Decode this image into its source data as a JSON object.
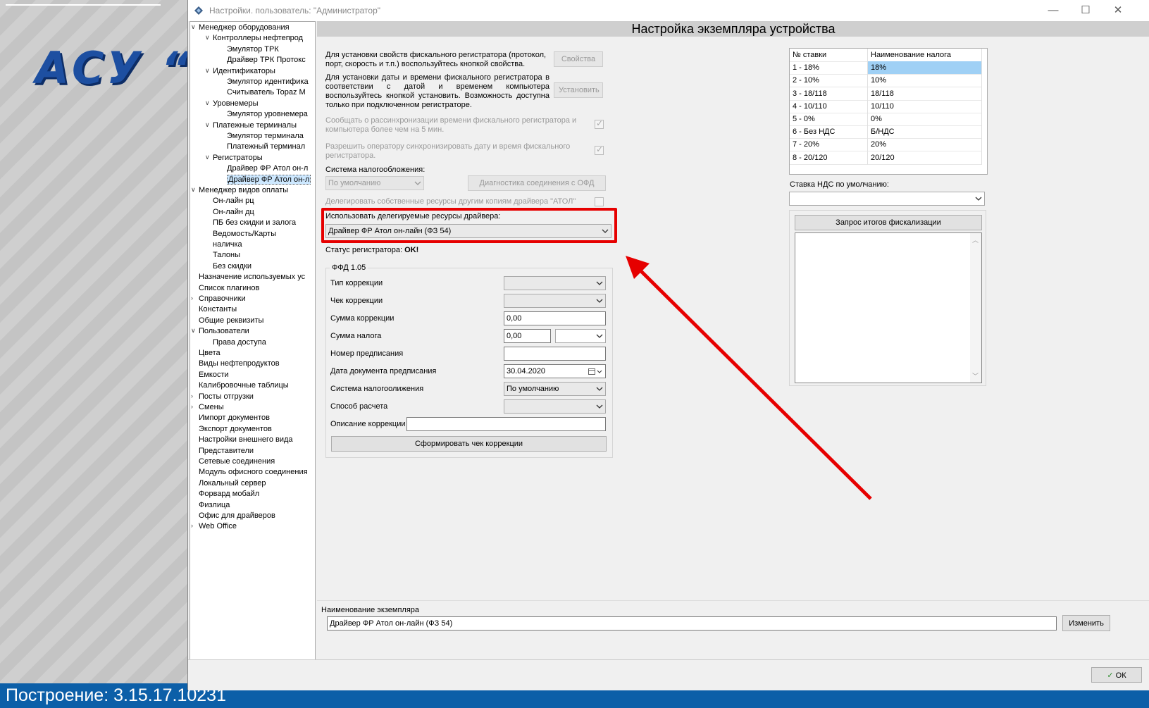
{
  "window": {
    "title": "Настройки. пользователь: \"Администратор\"",
    "minimize": "—",
    "maximize": "☐",
    "close": "✕"
  },
  "background": {
    "logo_text": "АСУ “",
    "build": "Построение: 3.15.17.10231"
  },
  "tree": {
    "items": [
      {
        "label": "Менеджер оборудования",
        "level": 0,
        "toggle": "expanded"
      },
      {
        "label": "Контроллеры нефтепрод",
        "level": 1,
        "toggle": "expanded"
      },
      {
        "label": "Эмулятор ТРК",
        "level": 2
      },
      {
        "label": "Драйвер ТРК Протокс",
        "level": 2
      },
      {
        "label": "Идентификаторы",
        "level": 1,
        "toggle": "expanded"
      },
      {
        "label": "Эмулятор идентифика",
        "level": 2
      },
      {
        "label": "Считыватель Topaz M",
        "level": 2
      },
      {
        "label": "Уровнемеры",
        "level": 1,
        "toggle": "expanded"
      },
      {
        "label": "Эмулятор уровнемера",
        "level": 2
      },
      {
        "label": "Платежные терминалы",
        "level": 1,
        "toggle": "expanded"
      },
      {
        "label": "Эмулятор терминала",
        "level": 2
      },
      {
        "label": "Платежный терминал",
        "level": 2
      },
      {
        "label": "Регистраторы",
        "level": 1,
        "toggle": "expanded"
      },
      {
        "label": "Драйвер ФР Атол он-л",
        "level": 2
      },
      {
        "label": "Драйвер ФР Атол он-л",
        "level": 2,
        "selected": true
      },
      {
        "label": "Менеджер видов оплаты",
        "level": 0,
        "toggle": "expanded"
      },
      {
        "label": "Он-лайн рц",
        "level": 1
      },
      {
        "label": "Он-лайн дц",
        "level": 1
      },
      {
        "label": "ПБ без скидки и залога",
        "level": 1
      },
      {
        "label": "Ведомость/Карты",
        "level": 1
      },
      {
        "label": "наличка",
        "level": 1
      },
      {
        "label": "Талоны",
        "level": 1
      },
      {
        "label": "Без скидки",
        "level": 1
      },
      {
        "label": "Назначение используемых ус",
        "level": 0
      },
      {
        "label": "Список плагинов",
        "level": 0
      },
      {
        "label": "Справочники",
        "level": 0,
        "toggle": "collapsed"
      },
      {
        "label": "Константы",
        "level": 0
      },
      {
        "label": "Общие реквизиты",
        "level": 0
      },
      {
        "label": "Пользователи",
        "level": 0,
        "toggle": "expanded"
      },
      {
        "label": "Права доступа",
        "level": 1
      },
      {
        "label": "Цвета",
        "level": 0
      },
      {
        "label": "Виды нефтепродуктов",
        "level": 0
      },
      {
        "label": "Емкости",
        "level": 0
      },
      {
        "label": "Калибровочные таблицы",
        "level": 0
      },
      {
        "label": "Посты отгрузки",
        "level": 0,
        "toggle": "collapsed"
      },
      {
        "label": "Смены",
        "level": 0,
        "toggle": "collapsed"
      },
      {
        "label": "Импорт документов",
        "level": 0
      },
      {
        "label": "Экспорт документов",
        "level": 0
      },
      {
        "label": "Настройки внешнего вида",
        "level": 0
      },
      {
        "label": "Представители",
        "level": 0
      },
      {
        "label": "Сетевые соединения",
        "level": 0
      },
      {
        "label": "Модуль офисного соединения",
        "level": 0
      },
      {
        "label": "Локальный сервер",
        "level": 0
      },
      {
        "label": "Форвард мобайл",
        "level": 0
      },
      {
        "label": "Физлица",
        "level": 0
      },
      {
        "label": "Офис для драйверов",
        "level": 0
      },
      {
        "label": "Web Office",
        "level": 0,
        "toggle": "collapsed"
      }
    ],
    "toggle_glyphs": {
      "expanded": "∨",
      "collapsed": "›"
    },
    "scroll_left": "‹",
    "scroll_right": "›"
  },
  "main": {
    "header": "Настройка экземпляра устройства",
    "props_text_1": "Для  установки  свойств фискального регистратора (протокол, порт, скорость и т.п.) воспользуйтесь кнопкой    свойства.",
    "props_button": "Свойства",
    "install_text_1": "Для  установки  даты  и времени фискального регистратора  в соответствии с датой и временем компьютера воспользуйтесь кнопкой    установить.   Возможность   доступна  только  при подключенном регистраторе.",
    "install_button": "Установить",
    "notify_text": "Сообщать о рассинхронизации времени фискального регистратора и компьютера более чем на 5 мин.",
    "notify_checked": true,
    "allow_text": "Разрешить оператору синхронизировать дату и время фискального регистратора.",
    "allow_checked": true,
    "tax_system_label": "Система налогообложения:",
    "tax_system_value": "По умолчанию",
    "diag_button": "Диагностика соединения с ОФД",
    "delegate_text": "Делегировать собственные ресурсы другим копиям драйвера \"АТОЛ\"",
    "delegate_checked": false,
    "use_delegated_label": "Использовать делегируемые ресурсы драйвера:",
    "use_delegated_value": "Драйвер ФР Атол он-лайн (ФЗ 54)",
    "status_label": "Статус регистратора:",
    "status_value": "OK!",
    "ffd": {
      "title": "ФФД 1.05",
      "fields": [
        {
          "label": "Тип коррекции",
          "type": "combo",
          "value": ""
        },
        {
          "label": "Чек коррекции",
          "type": "combo",
          "value": ""
        },
        {
          "label": "Сумма коррекции",
          "type": "input",
          "value": "0,00"
        },
        {
          "label": "Сумма налога",
          "type": "input-combo",
          "value": "0,00",
          "combo": ""
        },
        {
          "label": "Номер предписания",
          "type": "input",
          "value": ""
        },
        {
          "label": "Дата документа предписания",
          "type": "date",
          "value": "30.04.2020"
        },
        {
          "label": "Система налогоолижения",
          "type": "combo",
          "value": "По умолчанию"
        },
        {
          "label": "Способ расчета",
          "type": "combo",
          "value": ""
        },
        {
          "label": "Описание коррекции",
          "type": "wide-input",
          "value": ""
        }
      ],
      "button": "Сформировать чек коррекции"
    },
    "tax_table": {
      "headers": [
        "№ ставки",
        "Наименование налога"
      ],
      "rows": [
        [
          "1 - 18%",
          "18%"
        ],
        [
          "2 - 10%",
          "10%"
        ],
        [
          "3 - 18/118",
          "18/118"
        ],
        [
          "4 - 10/110",
          "10/110"
        ],
        [
          "5 - 0%",
          "0%"
        ],
        [
          "6 - Без НДС",
          "Б/НДС"
        ],
        [
          "7 - 20%",
          "20%"
        ],
        [
          "8 - 20/120",
          "20/120"
        ]
      ],
      "selected_row": 0
    },
    "vat_default_label": "Ставка НДС по умолчанию:",
    "vat_default_value": "",
    "fiscal_query_button": "Запрос итогов фискализации",
    "fiscal_memo": "",
    "instance_name_label": "Наименование экземпляра",
    "instance_name_value": "Драйвер ФР Атол он-лайн (ФЗ 54)",
    "rename_button": "Изменить"
  },
  "footer": {
    "ok_button": "ОК"
  },
  "colors": {
    "highlight": "#e60000",
    "build_bar": "#0c5fa8",
    "selection": "#9fd0f5"
  }
}
